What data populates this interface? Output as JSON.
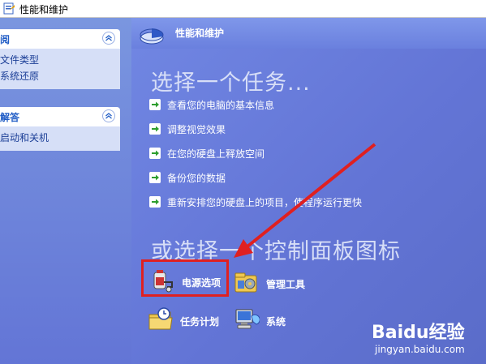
{
  "window": {
    "title": "性能和维护"
  },
  "left_pane": {
    "panels": [
      {
        "header": "阅",
        "links": [
          "文件类型",
          "系统还原"
        ]
      },
      {
        "header": "解答",
        "links": [
          "启动和关机"
        ]
      }
    ]
  },
  "main": {
    "header_title": "性能和维护",
    "pick_task_title": "选择一个任务...",
    "tasks": [
      "查看您的电脑的基本信息",
      "调整视觉效果",
      "在您的硬盘上释放空间",
      "备份您的数据",
      "重新安排您的硬盘上的项目，使程序运行更快"
    ],
    "pick_icon_title": "或选择一个控制面板图标",
    "control_panel_icons": [
      {
        "label": "电源选项",
        "icon": "power-options-icon"
      },
      {
        "label": "管理工具",
        "icon": "admin-tools-icon"
      },
      {
        "label": "任务计划",
        "icon": "scheduled-tasks-icon"
      },
      {
        "label": "系统",
        "icon": "system-icon"
      }
    ]
  },
  "watermark": {
    "brand": "Baidu经验",
    "url": "jingyan.baidu.com"
  },
  "colors": {
    "main_bg": "#6375d6",
    "link": "#215dc6",
    "annotation": "#e02020"
  }
}
